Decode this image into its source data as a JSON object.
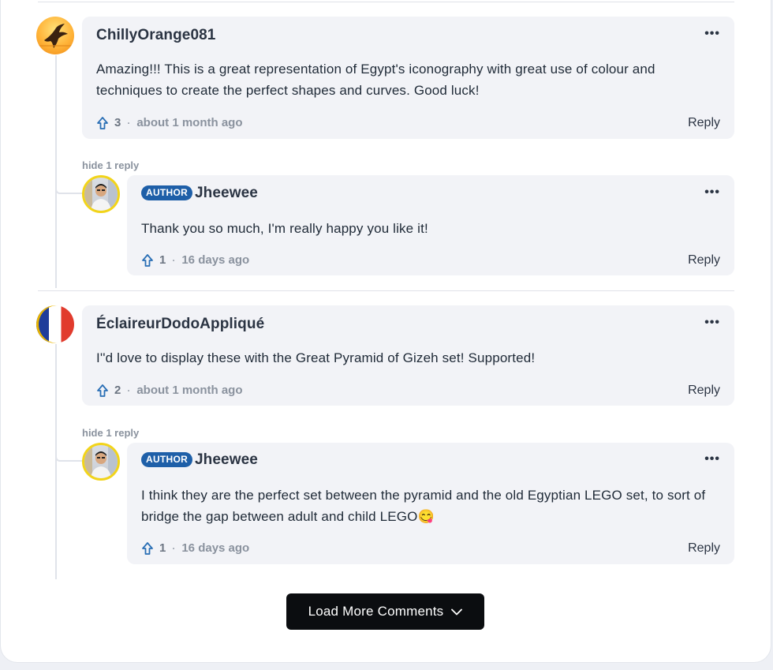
{
  "comments": [
    {
      "username": "ChillyOrange081",
      "text": "Amazing!!! This is a great representation of Egypt's iconography with great use of colour and techniques to create the perfect shapes and curves. Good luck!",
      "upvotes": "3",
      "time": "about 1 month ago",
      "reply_label": "Reply",
      "more_label": "•••",
      "hide_replies_label": "hide 1 reply",
      "avatar_icon": "bird-silhouette-avatar",
      "replies": [
        {
          "badge": "AUTHOR",
          "username": "Jheewee",
          "text": "Thank you so much, I'm really happy you like it!",
          "upvotes": "1",
          "time": "16 days ago",
          "reply_label": "Reply",
          "more_label": "•••",
          "avatar_icon": "person-photo-avatar"
        }
      ]
    },
    {
      "username": "ÉclaireurDodoAppliqué",
      "text": "I''d love to display these with the Great Pyramid of Gizeh set! Supported!",
      "upvotes": "2",
      "time": "about 1 month ago",
      "reply_label": "Reply",
      "more_label": "•••",
      "hide_replies_label": "hide 1 reply",
      "avatar_icon": "french-flag-avatar",
      "replies": [
        {
          "badge": "AUTHOR",
          "username": "Jheewee",
          "text": "I think they are the perfect set between the pyramid and the old Egyptian LEGO set, to sort of bridge the gap between adult and child LEGO😋",
          "upvotes": "1",
          "time": "16 days ago",
          "reply_label": "Reply",
          "more_label": "•••",
          "avatar_icon": "person-photo-avatar"
        }
      ]
    }
  ],
  "load_more_label": "Load More Comments",
  "colors": {
    "author_badge": "#1e5fa8",
    "upvote_icon": "#2a6fb5",
    "bubble_bg": "#f2f3f7",
    "button_bg": "#0b0d10"
  }
}
